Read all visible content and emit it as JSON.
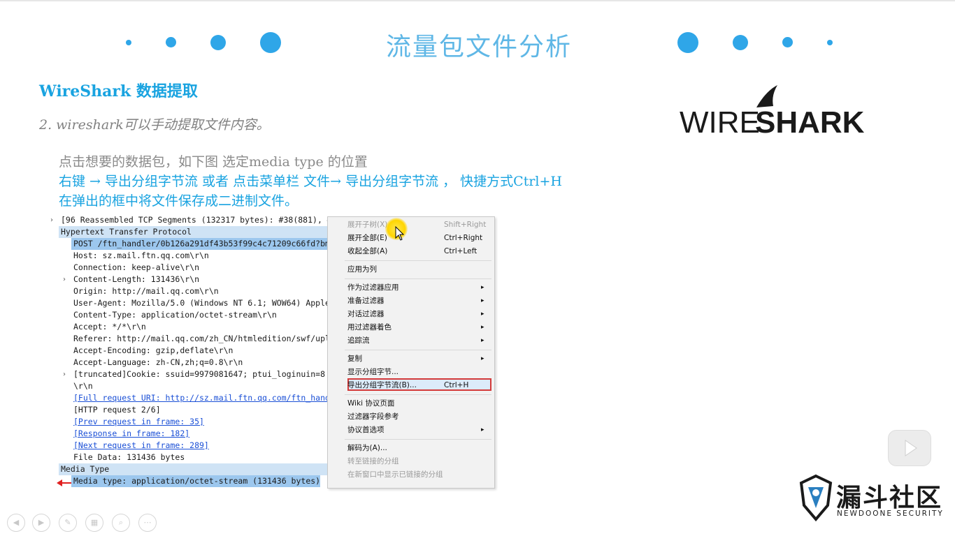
{
  "slide": {
    "title": "流量包文件分析",
    "subtitle": "WireShark 数据提取",
    "step": "2. wireshark可以手动提取文件内容。",
    "line1": "点击想要的数据包，如下图 选定media type 的位置",
    "line2": "右键 → 导出分组字节流   或者 点击菜单栏 文件→ 导出分组字节流 ， 快捷方式Ctrl+H",
    "line3": "在弹出的框中将文件保存成二进制文件。"
  },
  "logo": {
    "prefix": "WIRE",
    "suffix": "SHARK"
  },
  "packet_tree": [
    {
      "text": "[96 Reassembled TCP Segments (132317 bytes): #38(881), #",
      "indent": 0,
      "arrow": ">"
    },
    {
      "text": "Hypertext Transfer Protocol",
      "indent": 0,
      "arrow": "v"
    },
    {
      "text": "POST /ftn_handler/0b126a291df43b53f99c4c71209c66fd?bm",
      "indent": 1,
      "arrow": ">"
    },
    {
      "text": "Host: sz.mail.ftn.qq.com\\r\\n",
      "indent": 1,
      "arrow": ""
    },
    {
      "text": "Connection: keep-alive\\r\\n",
      "indent": 1,
      "arrow": ""
    },
    {
      "text": "Content-Length: 131436\\r\\n",
      "indent": 1,
      "arrow": ">"
    },
    {
      "text": "Origin: http://mail.qq.com\\r\\n",
      "indent": 1,
      "arrow": ""
    },
    {
      "text": "User-Agent: Mozilla/5.0 (Windows NT 6.1; WOW64) Apple",
      "indent": 1,
      "arrow": ""
    },
    {
      "text": "Content-Type: application/octet-stream\\r\\n",
      "indent": 1,
      "arrow": ""
    },
    {
      "text": "Accept: */*\\r\\n",
      "indent": 1,
      "arrow": ""
    },
    {
      "text": "Referer: http://mail.qq.com/zh_CN/htmledition/swf/upl",
      "indent": 1,
      "arrow": ""
    },
    {
      "text": "Accept-Encoding: gzip,deflate\\r\\n",
      "indent": 1,
      "arrow": ""
    },
    {
      "text": "Accept-Language: zh-CN,zh;q=0.8\\r\\n",
      "indent": 1,
      "arrow": ""
    },
    {
      "text": " [truncated]Cookie: ssuid=9979081647; ptui_loginuin=8",
      "indent": 1,
      "arrow": ">"
    },
    {
      "text": "\\r\\n",
      "indent": 1,
      "arrow": ""
    },
    {
      "text": "[Full request URI: http://sz.mail.ftn.qq.com/ftn_hand",
      "indent": 1,
      "arrow": ""
    },
    {
      "text": "[HTTP request 2/6]",
      "indent": 1,
      "arrow": ""
    },
    {
      "text": "[Prev request in frame: 35]",
      "indent": 1,
      "arrow": ""
    },
    {
      "text": "[Response in frame: 182]",
      "indent": 1,
      "arrow": ""
    },
    {
      "text": "[Next request in frame: 289]",
      "indent": 1,
      "arrow": ""
    },
    {
      "text": "File Data: 131436 bytes",
      "indent": 1,
      "arrow": ""
    },
    {
      "text": "Media Type",
      "indent": 0,
      "arrow": "v"
    },
    {
      "text": "Media type: application/octet-stream (131436 bytes)",
      "indent": 1,
      "arrow": ""
    }
  ],
  "context_menu": [
    {
      "label": "展开子树(X)",
      "shortcut": "Shift+Right",
      "disabled": true,
      "submenu": false
    },
    {
      "label": "展开全部(E)",
      "shortcut": "Ctrl+Right",
      "disabled": false,
      "submenu": false
    },
    {
      "label": "收起全部(A)",
      "shortcut": "Ctrl+Left",
      "disabled": false,
      "submenu": false
    },
    {
      "label": "应用为列",
      "shortcut": "",
      "disabled": false,
      "submenu": false
    },
    {
      "label": "作为过滤器应用",
      "shortcut": "",
      "disabled": false,
      "submenu": true
    },
    {
      "label": "准备过滤器",
      "shortcut": "",
      "disabled": false,
      "submenu": true
    },
    {
      "label": "对话过滤器",
      "shortcut": "",
      "disabled": false,
      "submenu": true
    },
    {
      "label": "用过滤器着色",
      "shortcut": "",
      "disabled": false,
      "submenu": true
    },
    {
      "label": "追踪流",
      "shortcut": "",
      "disabled": false,
      "submenu": true
    },
    {
      "label": "复制",
      "shortcut": "",
      "disabled": false,
      "submenu": true
    },
    {
      "label": "显示分组字节...",
      "shortcut": "",
      "disabled": false,
      "submenu": false
    },
    {
      "label": "导出分组字节流(B)...",
      "shortcut": "Ctrl+H",
      "disabled": false,
      "submenu": false
    },
    {
      "label": "Wiki 协议页面",
      "shortcut": "",
      "disabled": false,
      "submenu": false
    },
    {
      "label": "过滤器字段参考",
      "shortcut": "",
      "disabled": false,
      "submenu": false
    },
    {
      "label": "协议首选项",
      "shortcut": "",
      "disabled": false,
      "submenu": true
    },
    {
      "label": "解码为(A)...",
      "shortcut": "",
      "disabled": false,
      "submenu": false
    },
    {
      "label": "转至链接的分组",
      "shortcut": "",
      "disabled": true,
      "submenu": false
    },
    {
      "label": "在新窗口中显示已链接的分组",
      "shortcut": "",
      "disabled": true,
      "submenu": false
    }
  ],
  "submenu_glyph": "▸",
  "brand": {
    "cn": "漏斗社区",
    "en": "NEWDOONE SECURITY"
  },
  "colors": {
    "accent": "#19a3e0",
    "dot": "#2fa6e8",
    "highlight_border": "#d33a3a"
  }
}
